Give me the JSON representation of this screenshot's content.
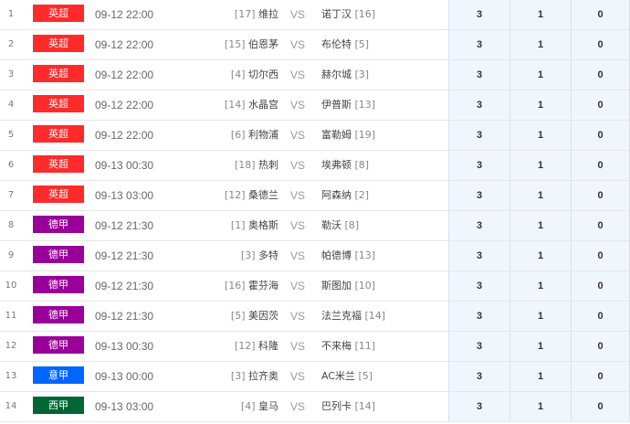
{
  "league_colors": {
    "英超": "#ff2a2a",
    "德甲": "#990099",
    "意甲": "#0066ff",
    "西甲": "#006633"
  },
  "matches": [
    {
      "idx": "1",
      "league": "英超",
      "time": "09-12 22:00",
      "home_rank": "[17]",
      "home": "维拉",
      "vs": "VS",
      "away": "诺丁汉",
      "away_rank": "[16]",
      "o1": "3",
      "o2": "1",
      "o3": "0"
    },
    {
      "idx": "2",
      "league": "英超",
      "time": "09-12 22:00",
      "home_rank": "[15]",
      "home": "伯恩茅",
      "vs": "VS",
      "away": "布伦特",
      "away_rank": "[5]",
      "o1": "3",
      "o2": "1",
      "o3": "0"
    },
    {
      "idx": "3",
      "league": "英超",
      "time": "09-12 22:00",
      "home_rank": "[4]",
      "home": "切尔西",
      "vs": "VS",
      "away": "赫尔城",
      "away_rank": "[3]",
      "o1": "3",
      "o2": "1",
      "o3": "0"
    },
    {
      "idx": "4",
      "league": "英超",
      "time": "09-12 22:00",
      "home_rank": "[14]",
      "home": "水晶宫",
      "vs": "VS",
      "away": "伊普斯",
      "away_rank": "[13]",
      "o1": "3",
      "o2": "1",
      "o3": "0"
    },
    {
      "idx": "5",
      "league": "英超",
      "time": "09-12 22:00",
      "home_rank": "[6]",
      "home": "利物浦",
      "vs": "VS",
      "away": "富勒姆",
      "away_rank": "[19]",
      "o1": "3",
      "o2": "1",
      "o3": "0"
    },
    {
      "idx": "6",
      "league": "英超",
      "time": "09-13 00:30",
      "home_rank": "[18]",
      "home": "热刺",
      "vs": "VS",
      "away": "埃弗顿",
      "away_rank": "[8]",
      "o1": "3",
      "o2": "1",
      "o3": "0"
    },
    {
      "idx": "7",
      "league": "英超",
      "time": "09-13 03:00",
      "home_rank": "[12]",
      "home": "桑德兰",
      "vs": "VS",
      "away": "阿森纳",
      "away_rank": "[2]",
      "o1": "3",
      "o2": "1",
      "o3": "0"
    },
    {
      "idx": "8",
      "league": "德甲",
      "time": "09-12 21:30",
      "home_rank": "[1]",
      "home": "奥格斯",
      "vs": "VS",
      "away": "勒沃",
      "away_rank": "[8]",
      "o1": "3",
      "o2": "1",
      "o3": "0"
    },
    {
      "idx": "9",
      "league": "德甲",
      "time": "09-12 21:30",
      "home_rank": "[3]",
      "home": "多特",
      "vs": "VS",
      "away": "帕德博",
      "away_rank": "[13]",
      "o1": "3",
      "o2": "1",
      "o3": "0"
    },
    {
      "idx": "10",
      "league": "德甲",
      "time": "09-12 21:30",
      "home_rank": "[16]",
      "home": "霍芬海",
      "vs": "VS",
      "away": "斯图加",
      "away_rank": "[10]",
      "o1": "3",
      "o2": "1",
      "o3": "0"
    },
    {
      "idx": "11",
      "league": "德甲",
      "time": "09-12 21:30",
      "home_rank": "[5]",
      "home": "美因茨",
      "vs": "VS",
      "away": "法兰克福",
      "away_rank": "[14]",
      "o1": "3",
      "o2": "1",
      "o3": "0"
    },
    {
      "idx": "12",
      "league": "德甲",
      "time": "09-13 00:30",
      "home_rank": "[12]",
      "home": "科隆",
      "vs": "VS",
      "away": "不来梅",
      "away_rank": "[11]",
      "o1": "3",
      "o2": "1",
      "o3": "0"
    },
    {
      "idx": "13",
      "league": "意甲",
      "time": "09-13 00:00",
      "home_rank": "[3]",
      "home": "拉齐奥",
      "vs": "VS",
      "away": "AC米兰",
      "away_rank": "[5]",
      "o1": "3",
      "o2": "1",
      "o3": "0"
    },
    {
      "idx": "14",
      "league": "西甲",
      "time": "09-13 03:00",
      "home_rank": "[4]",
      "home": "皇马",
      "vs": "VS",
      "away": "巴列卡",
      "away_rank": "[14]",
      "o1": "3",
      "o2": "1",
      "o3": "0"
    }
  ]
}
